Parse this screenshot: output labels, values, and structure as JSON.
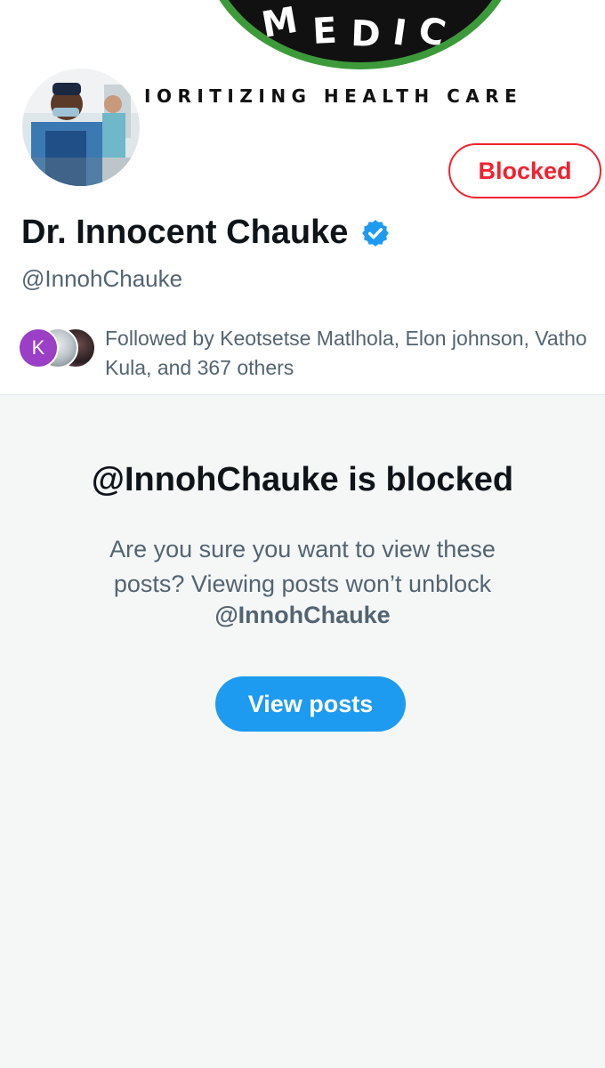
{
  "banner": {
    "logo_text": "P MEDIC",
    "tagline": "IORITIZING HEALTH CARE",
    "colors": {
      "ring": "#3d9a3a",
      "disk": "#111111",
      "text": "#ffffff"
    }
  },
  "profile": {
    "display_name": "Dr. Innocent Chauke",
    "handle": "@InnohChauke",
    "verified": true,
    "verified_icon": "verified-badge-icon",
    "action_button": "Blocked"
  },
  "followed_by": {
    "avatar_initial": "K",
    "text": "Followed by Keotsetse Matlhola, Elon johnson, Vatho Kula, and 367 others"
  },
  "blocked_notice": {
    "title": "@InnohChauke is blocked",
    "message": "Are you sure you want to view these posts? Viewing posts won’t unblock",
    "handle": "@InnohChauke",
    "button": "View posts"
  },
  "colors": {
    "accent": "#1d9bf0",
    "blocked_red": "#f4212e",
    "secondary_text": "#536471",
    "panel_bg": "#f5f7f7"
  }
}
